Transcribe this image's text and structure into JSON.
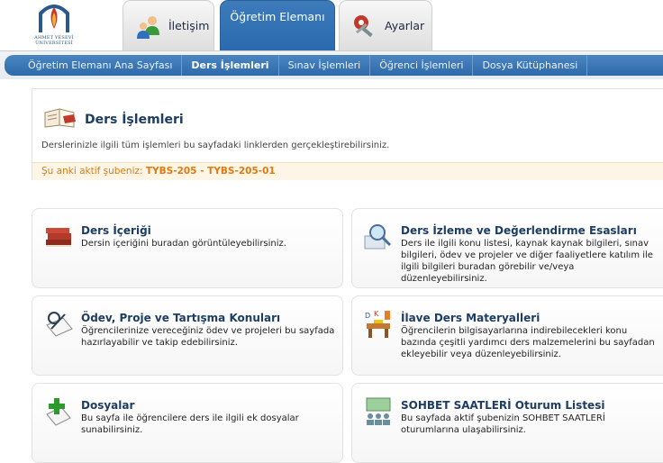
{
  "header": {
    "logo_text": "AHMET YESEVİ\nÜNİVERSİTESİ",
    "tabs": [
      {
        "label": "İletişim",
        "icon": "contacts-icon",
        "active": false
      },
      {
        "label": "Öğretim Elemanı",
        "icon": "",
        "active": true
      },
      {
        "label": "Ayarlar",
        "icon": "settings-tools-icon",
        "active": false
      }
    ]
  },
  "subnav": {
    "items": [
      {
        "label": "Öğretim Elemanı Ana Sayfası",
        "active": false
      },
      {
        "label": "Ders İşlemleri",
        "active": true
      },
      {
        "label": "Sınav İşlemleri",
        "active": false
      },
      {
        "label": "Öğrenci İşlemleri",
        "active": false
      },
      {
        "label": "Dosya Kütüphanesi",
        "active": false
      }
    ]
  },
  "page": {
    "title": "Ders İşlemleri",
    "description": "Derslerinizle ilgili tüm işlemleri bu sayfadaki linklerden gerçekleştirebilirsiniz.",
    "sube_label": "Şu anki aktif şubeniz: ",
    "sube_value": "TYBS-205 - TYBS-205-01"
  },
  "cards": [
    {
      "title": "Ders İçeriği",
      "desc": "Dersin içeriğini buradan görüntüleyebilirsiniz.",
      "icon": "books-icon"
    },
    {
      "title": "Ders İzleme ve Değerlendirme Esasları",
      "desc": "Ders ile ilgili konu listesi, kaynak kaynak bilgileri, sınav bilgileri, ödev ve projeler ve diğer faaliyetlere katılım ile ilgili bilgileri buradan görebilir ve/veya düzenleyebilirsiniz.",
      "icon": "magnifier-icon"
    },
    {
      "title": "Ödev, Proje ve Tartışma Konuları",
      "desc": "Öğrencilerinize vereceğiniz ödev ve projeleri bu sayfada hazırlayabilir ve takip edebilirsiniz.",
      "icon": "pen-paper-icon"
    },
    {
      "title": "İlave Ders Materyalleri",
      "desc": "Öğrencilerin bilgisayarlarına indirebilecekleri konu bazında çeşitli yardımcı ders malzemelerini bu sayfadan ekleyebilir veya düzenleyebilirsiniz.",
      "icon": "desk-materials-icon"
    },
    {
      "title": "Dosyalar",
      "desc": "Bu sayfa ile öğrencilere ders ile ilgili ek dosyalar sunabilirsiniz.",
      "icon": "add-file-icon"
    },
    {
      "title": "SOHBET SAATLERİ Oturum Listesi",
      "desc": "Bu sayfada aktif şubenizin SOHBET SAATLERİ oturumlarına ulaşabilirsiniz.",
      "icon": "meeting-icon"
    }
  ]
}
